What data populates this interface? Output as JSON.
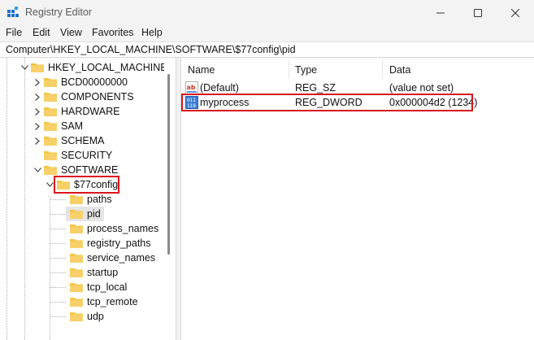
{
  "window": {
    "title": "Registry Editor",
    "controls": {
      "minimize": "minimize",
      "maximize": "maximize",
      "close": "close"
    }
  },
  "menu": [
    "File",
    "Edit",
    "View",
    "Favorites",
    "Help"
  ],
  "address": "Computer\\HKEY_LOCAL_MACHINE\\SOFTWARE\\$77config\\pid",
  "tree": {
    "root": "HKEY_LOCAL_MACHINE",
    "top_keys": [
      "BCD00000000",
      "COMPONENTS",
      "HARDWARE",
      "SAM",
      "SCHEMA",
      "SECURITY"
    ],
    "software": "SOFTWARE",
    "config_key": "$77config",
    "config_children": [
      "paths",
      "pid",
      "process_names",
      "registry_paths",
      "service_names",
      "startup",
      "tcp_local",
      "tcp_remote",
      "udp"
    ],
    "selected": "pid"
  },
  "list": {
    "columns": {
      "name": "Name",
      "type": "Type",
      "data": "Data"
    },
    "rows": [
      {
        "name": "(Default)",
        "type": "REG_SZ",
        "data": "(value not set)",
        "icon": "string-value-icon"
      },
      {
        "name": "myprocess",
        "type": "REG_DWORD",
        "data": "0x000004d2 (1234)",
        "icon": "binary-value-icon"
      }
    ]
  },
  "colors": {
    "highlight": "#d9151b",
    "folder": "#f4c542",
    "selection": "#e5e5e5"
  }
}
